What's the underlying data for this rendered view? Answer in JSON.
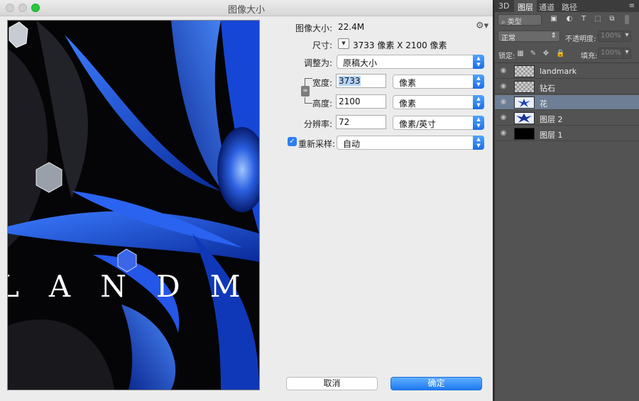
{
  "dialog": {
    "title": "图像大小",
    "image_size_label": "图像大小:",
    "image_size_value": "22.4M",
    "dimensions_label": "尺寸:",
    "dimensions_value": "3733 像素  X  2100 像素",
    "fit_to_label": "调整为:",
    "fit_to_value": "原稿大小",
    "width_label": "宽度:",
    "width_value": "3733",
    "width_unit": "像素",
    "height_label": "高度:",
    "height_value": "2100",
    "height_unit": "像素",
    "resolution_label": "分辨率:",
    "resolution_value": "72",
    "resolution_unit": "像素/英寸",
    "resample_label": "重新采样:",
    "resample_checked": true,
    "resample_value": "自动",
    "cancel_label": "取消",
    "ok_label": "确定"
  },
  "preview": {
    "brand_text": "LANDM"
  },
  "panel": {
    "tabs": [
      "3D",
      "图层",
      "通道",
      "路径"
    ],
    "active_tab": "图层",
    "filter_label": "类型",
    "blend_mode": "正常",
    "opacity_label": "不透明度:",
    "opacity_value": "100%",
    "lock_label": "锁定:",
    "fill_label": "填充:",
    "fill_value": "100%",
    "layers": [
      {
        "name": "landmark",
        "thumb": "checker",
        "selected": false
      },
      {
        "name": "钻石",
        "thumb": "checker",
        "selected": false
      },
      {
        "name": "花",
        "thumb": "flower",
        "selected": true
      },
      {
        "name": "图层 2",
        "thumb": "flower",
        "selected": false
      },
      {
        "name": "图层 1",
        "thumb": "black",
        "selected": false
      }
    ]
  },
  "colors": {
    "accent": "#1f79ef",
    "selected_layer": "#6d7e95",
    "panel_bg": "#535353",
    "dialog_bg": "#ececec"
  }
}
